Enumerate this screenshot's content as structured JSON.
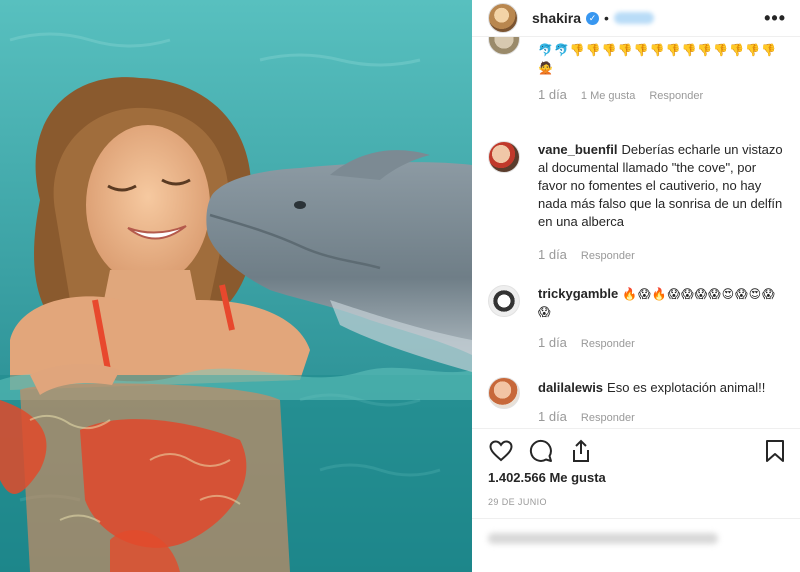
{
  "post": {
    "author": "shakira",
    "dot": "•",
    "more_icon": "more-dots-icon",
    "more_label": "•••",
    "likes": "1.402.566 Me gusta",
    "date": "29 DE JUNIO"
  },
  "comments": [
    {
      "user": "",
      "text": "🐬🐬👎👎👎👎👎👎👎👎👎👎👎👎👎",
      "text2": "🙅",
      "age": "1 día",
      "likes": "1 Me gusta",
      "reply": "Responder"
    },
    {
      "user": "vane_buenfil",
      "text": "Deberías echarle un vistazo al documental llamado \"the cove\", por favor no fomentes el cautiverio, no hay nada más falso que la sonrisa de un delfín en una alberca",
      "age": "1 día",
      "reply": "Responder"
    },
    {
      "user": "trickygamble",
      "text": "🔥😱🔥😱😱😱😱😍😱😍😱😱",
      "age": "1 día",
      "reply": "Responder"
    },
    {
      "user": "dalilalewis",
      "text": "Eso es explotación animal!!",
      "age": "1 día",
      "reply": "Responder"
    }
  ],
  "icons": {
    "like": "heart-icon",
    "comment": "comment-icon",
    "share": "share-icon",
    "save": "bookmark-icon"
  },
  "colors": {
    "verified": "#3897f0",
    "meta_text": "#999999",
    "water": "#2b9ea1"
  }
}
